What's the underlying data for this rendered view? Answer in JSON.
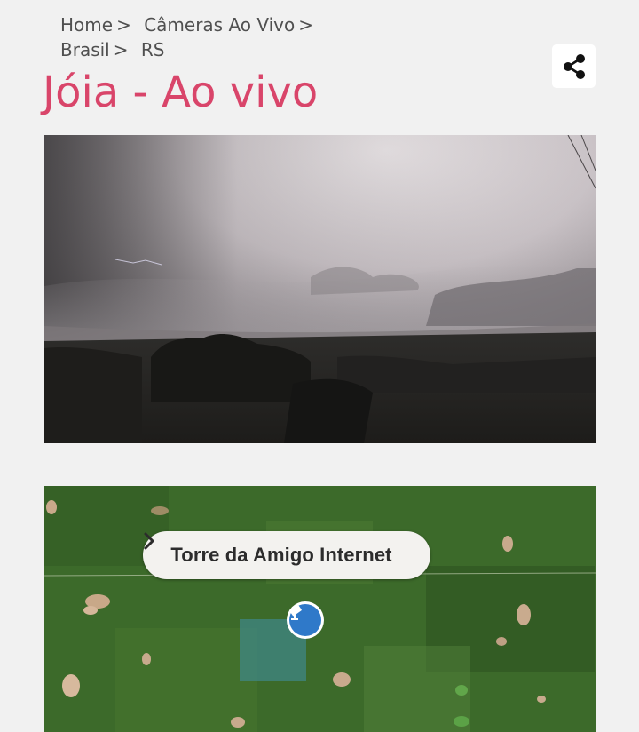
{
  "breadcrumb": {
    "items": [
      {
        "label": "Home"
      },
      {
        "label": "Câmeras Ao Vivo"
      },
      {
        "label": "Brasil"
      },
      {
        "label": "RS"
      }
    ],
    "separator": ">"
  },
  "page": {
    "title": "Jóia - Ao vivo"
  },
  "share": {
    "icon": "share-icon"
  },
  "camera": {
    "scene": "night-sky-lightning-landscape"
  },
  "map": {
    "popup_label": "Torre da Amigo Internet",
    "popup_chevron_icon": "chevron-right-icon",
    "marker_icon": "camera-marker-icon"
  },
  "colors": {
    "title": "#d9456a",
    "background": "#f1f1f1",
    "marker": "#2f79c9"
  }
}
